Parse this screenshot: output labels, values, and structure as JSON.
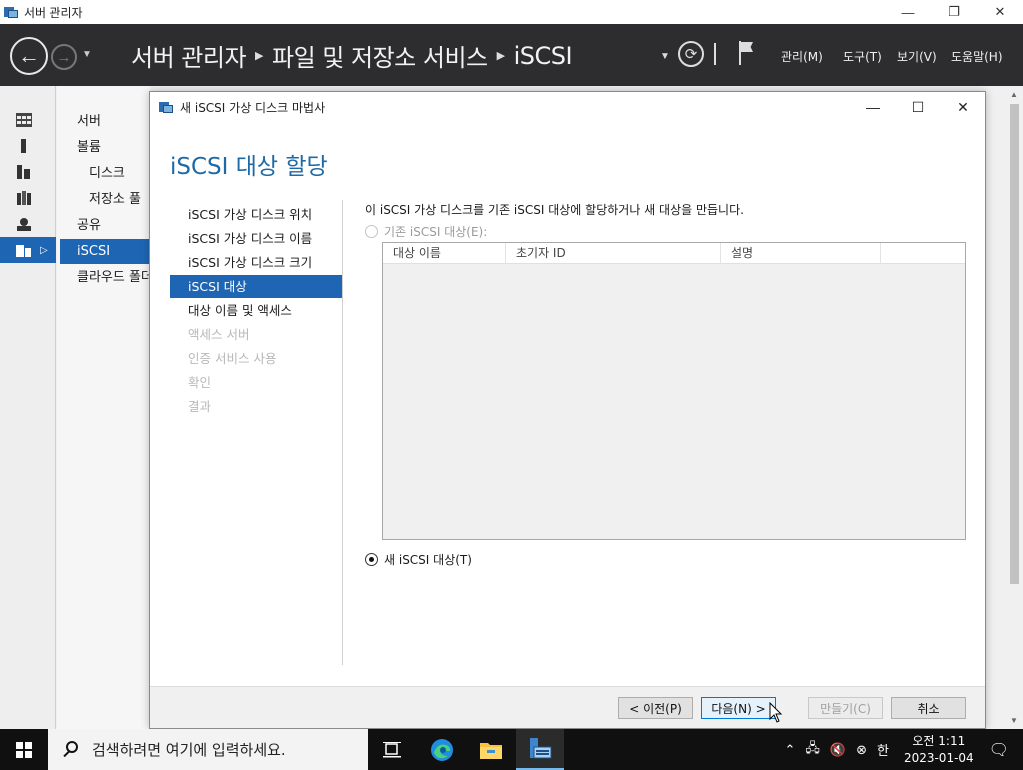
{
  "window": {
    "title": "서버 관리자",
    "minimize": "—",
    "restore": "❐",
    "close": "✕"
  },
  "header": {
    "breadcrumb": [
      "서버 관리자",
      "파일 및 저장소 서비스",
      "iSCSI"
    ],
    "menus": [
      "관리(M)",
      "도구(T)",
      "보기(V)",
      "도움말(H)"
    ]
  },
  "rail": {
    "icons": [
      "grid-icon",
      "server-icon",
      "servers-icon",
      "server-group-icon",
      "storage-icon",
      "file-services-icon"
    ]
  },
  "subnav": {
    "items": [
      {
        "label": "서버"
      },
      {
        "label": "볼륨"
      },
      {
        "label": "디스크"
      },
      {
        "label": "저장소 풀"
      },
      {
        "label": "공유"
      },
      {
        "label": "iSCSI"
      },
      {
        "label": "클라우드 폴더"
      }
    ]
  },
  "dialog": {
    "title": "새 iSCSI 가상 디스크 마법사",
    "heading": "iSCSI 대상 할당",
    "steps": [
      {
        "label": "iSCSI 가상 디스크 위치"
      },
      {
        "label": "iSCSI 가상 디스크 이름"
      },
      {
        "label": "iSCSI 가상 디스크 크기"
      },
      {
        "label": "iSCSI 대상"
      },
      {
        "label": "대상 이름 및 액세스"
      },
      {
        "label": "액세스 서버"
      },
      {
        "label": "인증 서비스 사용"
      },
      {
        "label": "확인"
      },
      {
        "label": "결과"
      }
    ],
    "intro": "이 iSCSI 가상 디스크를 기존 iSCSI 대상에 할당하거나 새 대상을 만듭니다.",
    "existing_option": "기존 iSCSI 대상(E):",
    "new_option": "새 iSCSI 대상(T)",
    "columns": [
      "대상 이름",
      "초기자 ID",
      "설명"
    ],
    "buttons": {
      "prev": "< 이전(P)",
      "next": "다음(N) >",
      "create": "만들기(C)",
      "cancel": "취소"
    }
  },
  "taskbar": {
    "search_placeholder": "검색하려면 여기에 입력하세요.",
    "ime": "한",
    "time": "오전 1:11",
    "date": "2023-01-04"
  },
  "colors": {
    "accent": "#1e66b4",
    "heading": "#1f6aa5",
    "header_bg": "#2d2d30"
  }
}
